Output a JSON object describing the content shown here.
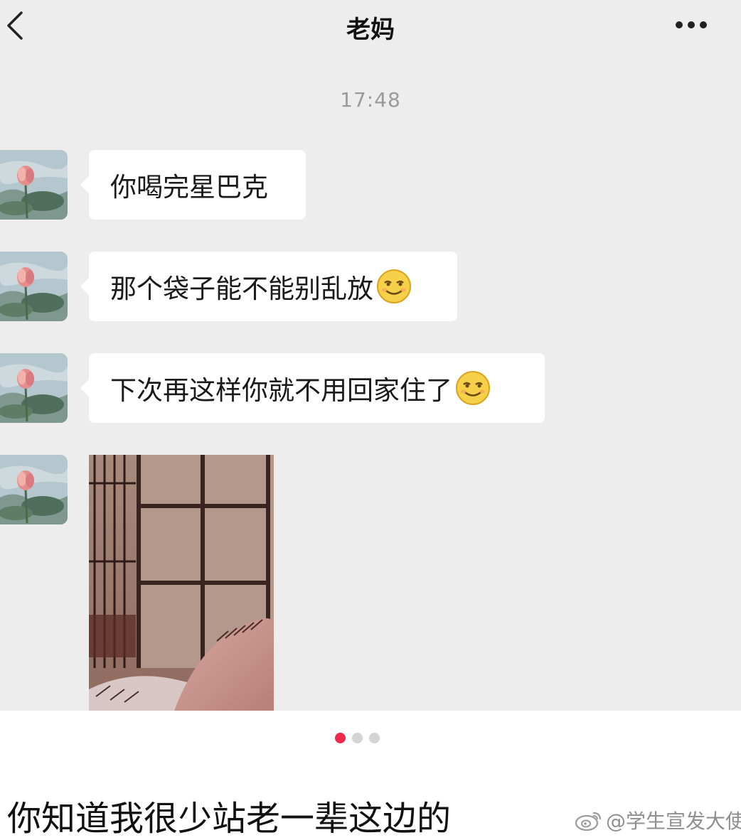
{
  "nav": {
    "title": "老妈"
  },
  "chat": {
    "timestamp": "17:48",
    "messages": [
      {
        "text": "你喝完星巴克",
        "emoji": null
      },
      {
        "text": "那个袋子能不能别乱放",
        "emoji": "smirk-emoji"
      },
      {
        "text": "下次再这样你就不用回家住了",
        "emoji": "smirk-emoji"
      }
    ],
    "image_message": {
      "type": "photo"
    }
  },
  "pager": {
    "pages": 3,
    "active": 1
  },
  "post": {
    "caption": "你知道我很少站老一辈这边的",
    "watermark": "@学生宣发大使"
  }
}
